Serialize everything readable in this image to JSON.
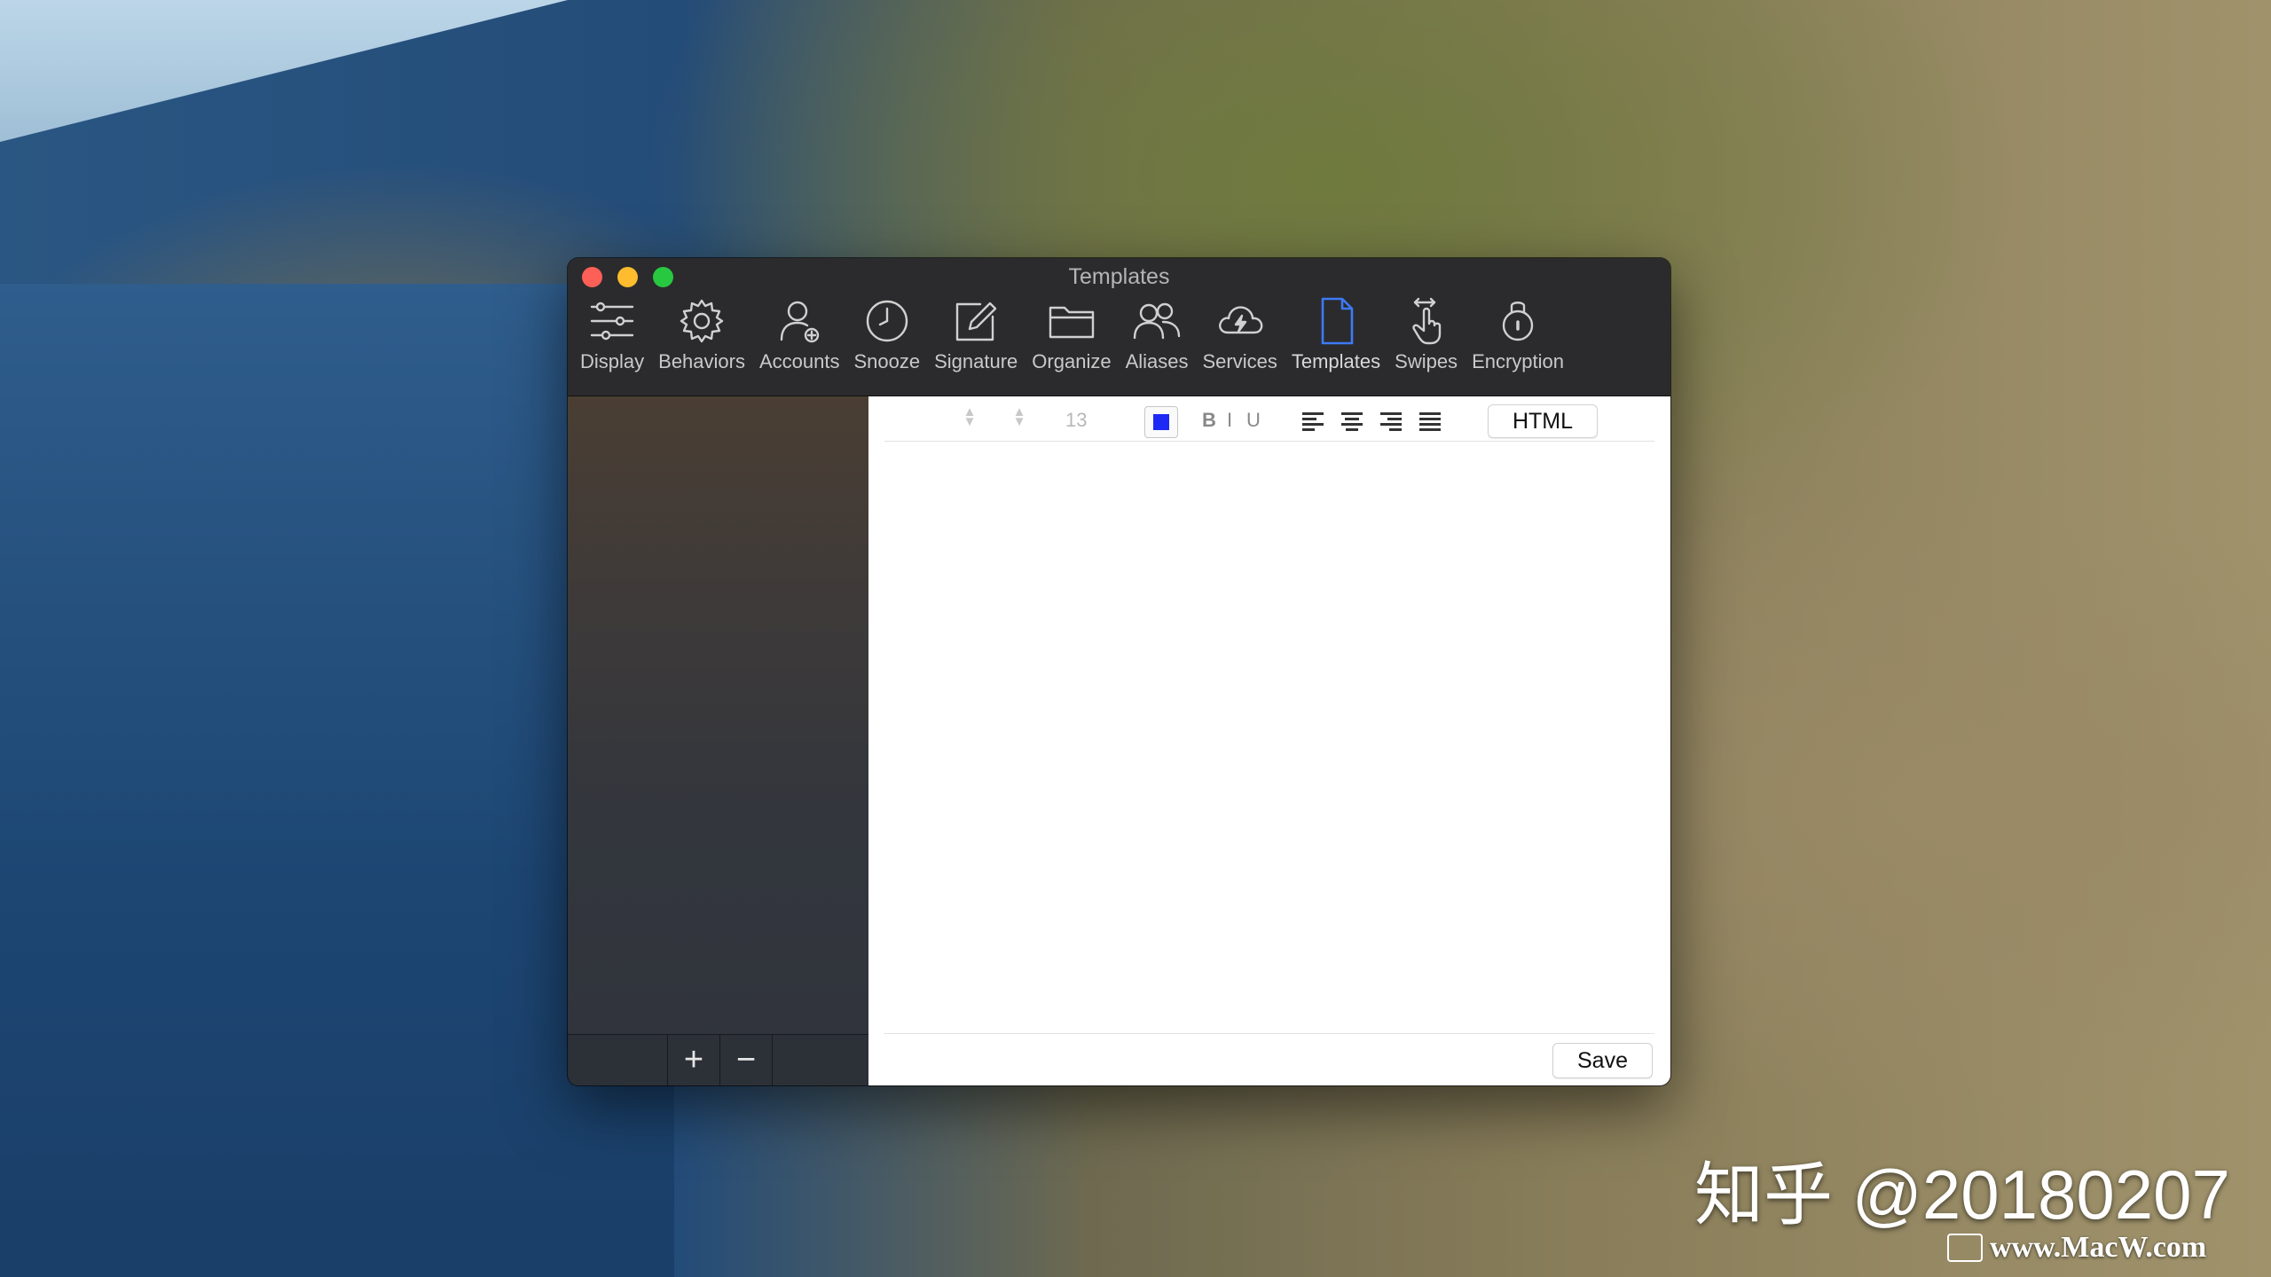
{
  "window": {
    "title": "Templates"
  },
  "toolbar": {
    "items": [
      {
        "label": "Display",
        "icon": "sliders-icon"
      },
      {
        "label": "Behaviors",
        "icon": "gear-icon"
      },
      {
        "label": "Accounts",
        "icon": "person-add-icon"
      },
      {
        "label": "Snooze",
        "icon": "clock-icon"
      },
      {
        "label": "Signature",
        "icon": "pencil-square-icon"
      },
      {
        "label": "Organize",
        "icon": "folder-icon"
      },
      {
        "label": "Aliases",
        "icon": "people-icon"
      },
      {
        "label": "Services",
        "icon": "cloud-bolt-icon"
      },
      {
        "label": "Templates",
        "icon": "document-icon",
        "active": true
      },
      {
        "label": "Swipes",
        "icon": "hand-swipe-icon"
      },
      {
        "label": "Encryption",
        "icon": "lock-icon"
      }
    ],
    "active_color": "#3d7bf5"
  },
  "sidebar": {
    "add_label": "+",
    "remove_label": "−"
  },
  "editor": {
    "font_size": "13",
    "text_color": "#1d29f5",
    "bold_label": "B",
    "italic_label": "I",
    "underline_label": "U",
    "html_label": "HTML",
    "save_label": "Save"
  },
  "watermark": {
    "text": "知乎 @20180207",
    "site": "www.MacW.com"
  }
}
